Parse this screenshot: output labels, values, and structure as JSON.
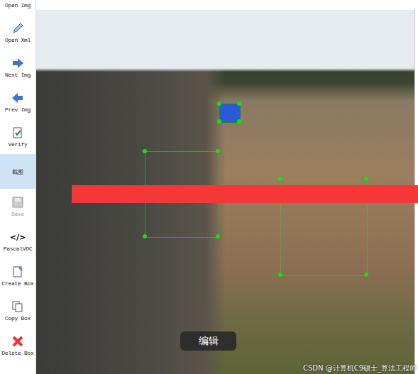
{
  "toolbar": {
    "items": [
      {
        "label": "Open Img",
        "selected": false,
        "disabled": false
      },
      {
        "label": "Open Xml",
        "selected": false,
        "disabled": false
      },
      {
        "label": "Next Img",
        "selected": false,
        "disabled": false
      },
      {
        "label": "Prev Img",
        "selected": false,
        "disabled": false
      },
      {
        "label": "Verify",
        "selected": false,
        "disabled": false
      },
      {
        "label": "截图",
        "selected": true,
        "disabled": false
      },
      {
        "label": "Save",
        "selected": false,
        "disabled": true
      },
      {
        "label": "PascalVOC",
        "selected": false,
        "disabled": false,
        "glyph": "</>"
      },
      {
        "label": "Create Box",
        "selected": false,
        "disabled": false
      },
      {
        "label": "Copy Box",
        "selected": false,
        "disabled": false
      },
      {
        "label": "Delete Box",
        "selected": false,
        "disabled": false
      }
    ]
  },
  "annotations": [
    {
      "selected": true
    },
    {
      "selected": false
    },
    {
      "selected": false
    }
  ],
  "tooltip": "编辑",
  "watermark": "CSDN @计算机C9硕士_算法工程师"
}
